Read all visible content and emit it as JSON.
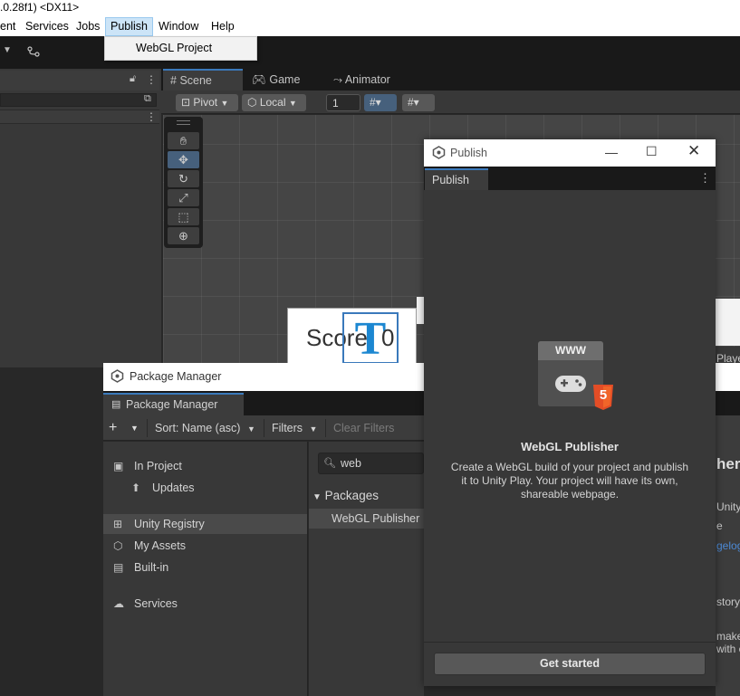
{
  "window": {
    "title_fragment": ".0.28f1) <DX11>"
  },
  "menubar": {
    "items": [
      {
        "label": "ent"
      },
      {
        "label": "Services"
      },
      {
        "label": "Jobs"
      },
      {
        "label": "Publish"
      },
      {
        "label": "Window"
      },
      {
        "label": "Help"
      }
    ],
    "dropdown_item": "WebGL Project"
  },
  "scene": {
    "tabs": [
      {
        "label": "Scene",
        "icon": "grid-icon"
      },
      {
        "label": "Game",
        "icon": "gamepad-icon"
      },
      {
        "label": "Animator",
        "icon": "animator-icon"
      }
    ],
    "pivot_label": "Pivot",
    "local_label": "Local",
    "snap_value": "1",
    "score_label": "Score",
    "score_value": "0"
  },
  "package_manager": {
    "title": "Package Manager",
    "tab_label": "Package Manager",
    "add_label": "+",
    "sort_label": "Sort: Name (asc)",
    "filters_label": "Filters",
    "clear_filters_label": "Clear Filters",
    "search_value": "web",
    "sidebar": [
      {
        "label": "In Project",
        "icon": "project-icon"
      },
      {
        "label": "Updates",
        "icon": "update-icon"
      },
      {
        "label": "Unity Registry",
        "icon": "grid-icon"
      },
      {
        "label": "My Assets",
        "icon": "cube-icon"
      },
      {
        "label": "Built-in",
        "icon": "builtin-icon"
      },
      {
        "label": "Services",
        "icon": "cloud-icon"
      }
    ],
    "list_group": "Packages",
    "list_item": "WebGL Publisher",
    "right_fragments": [
      "her",
      "Unity",
      "e",
      "gelog",
      "story",
      "make",
      "with c",
      "Playe"
    ]
  },
  "publish": {
    "window_title": "Publish",
    "tab_label": "Publish",
    "www_label": "WWW",
    "html5_label": "5",
    "heading": "WebGL Publisher",
    "description": "Create a WebGL build of your project and publish it to Unity Play. Your project will have its own, shareable webpage.",
    "button_label": "Get started"
  },
  "colors": {
    "accent": "#3a79bb",
    "html5_orange": "#e44d26",
    "panel": "#383838",
    "dark": "#191919"
  }
}
